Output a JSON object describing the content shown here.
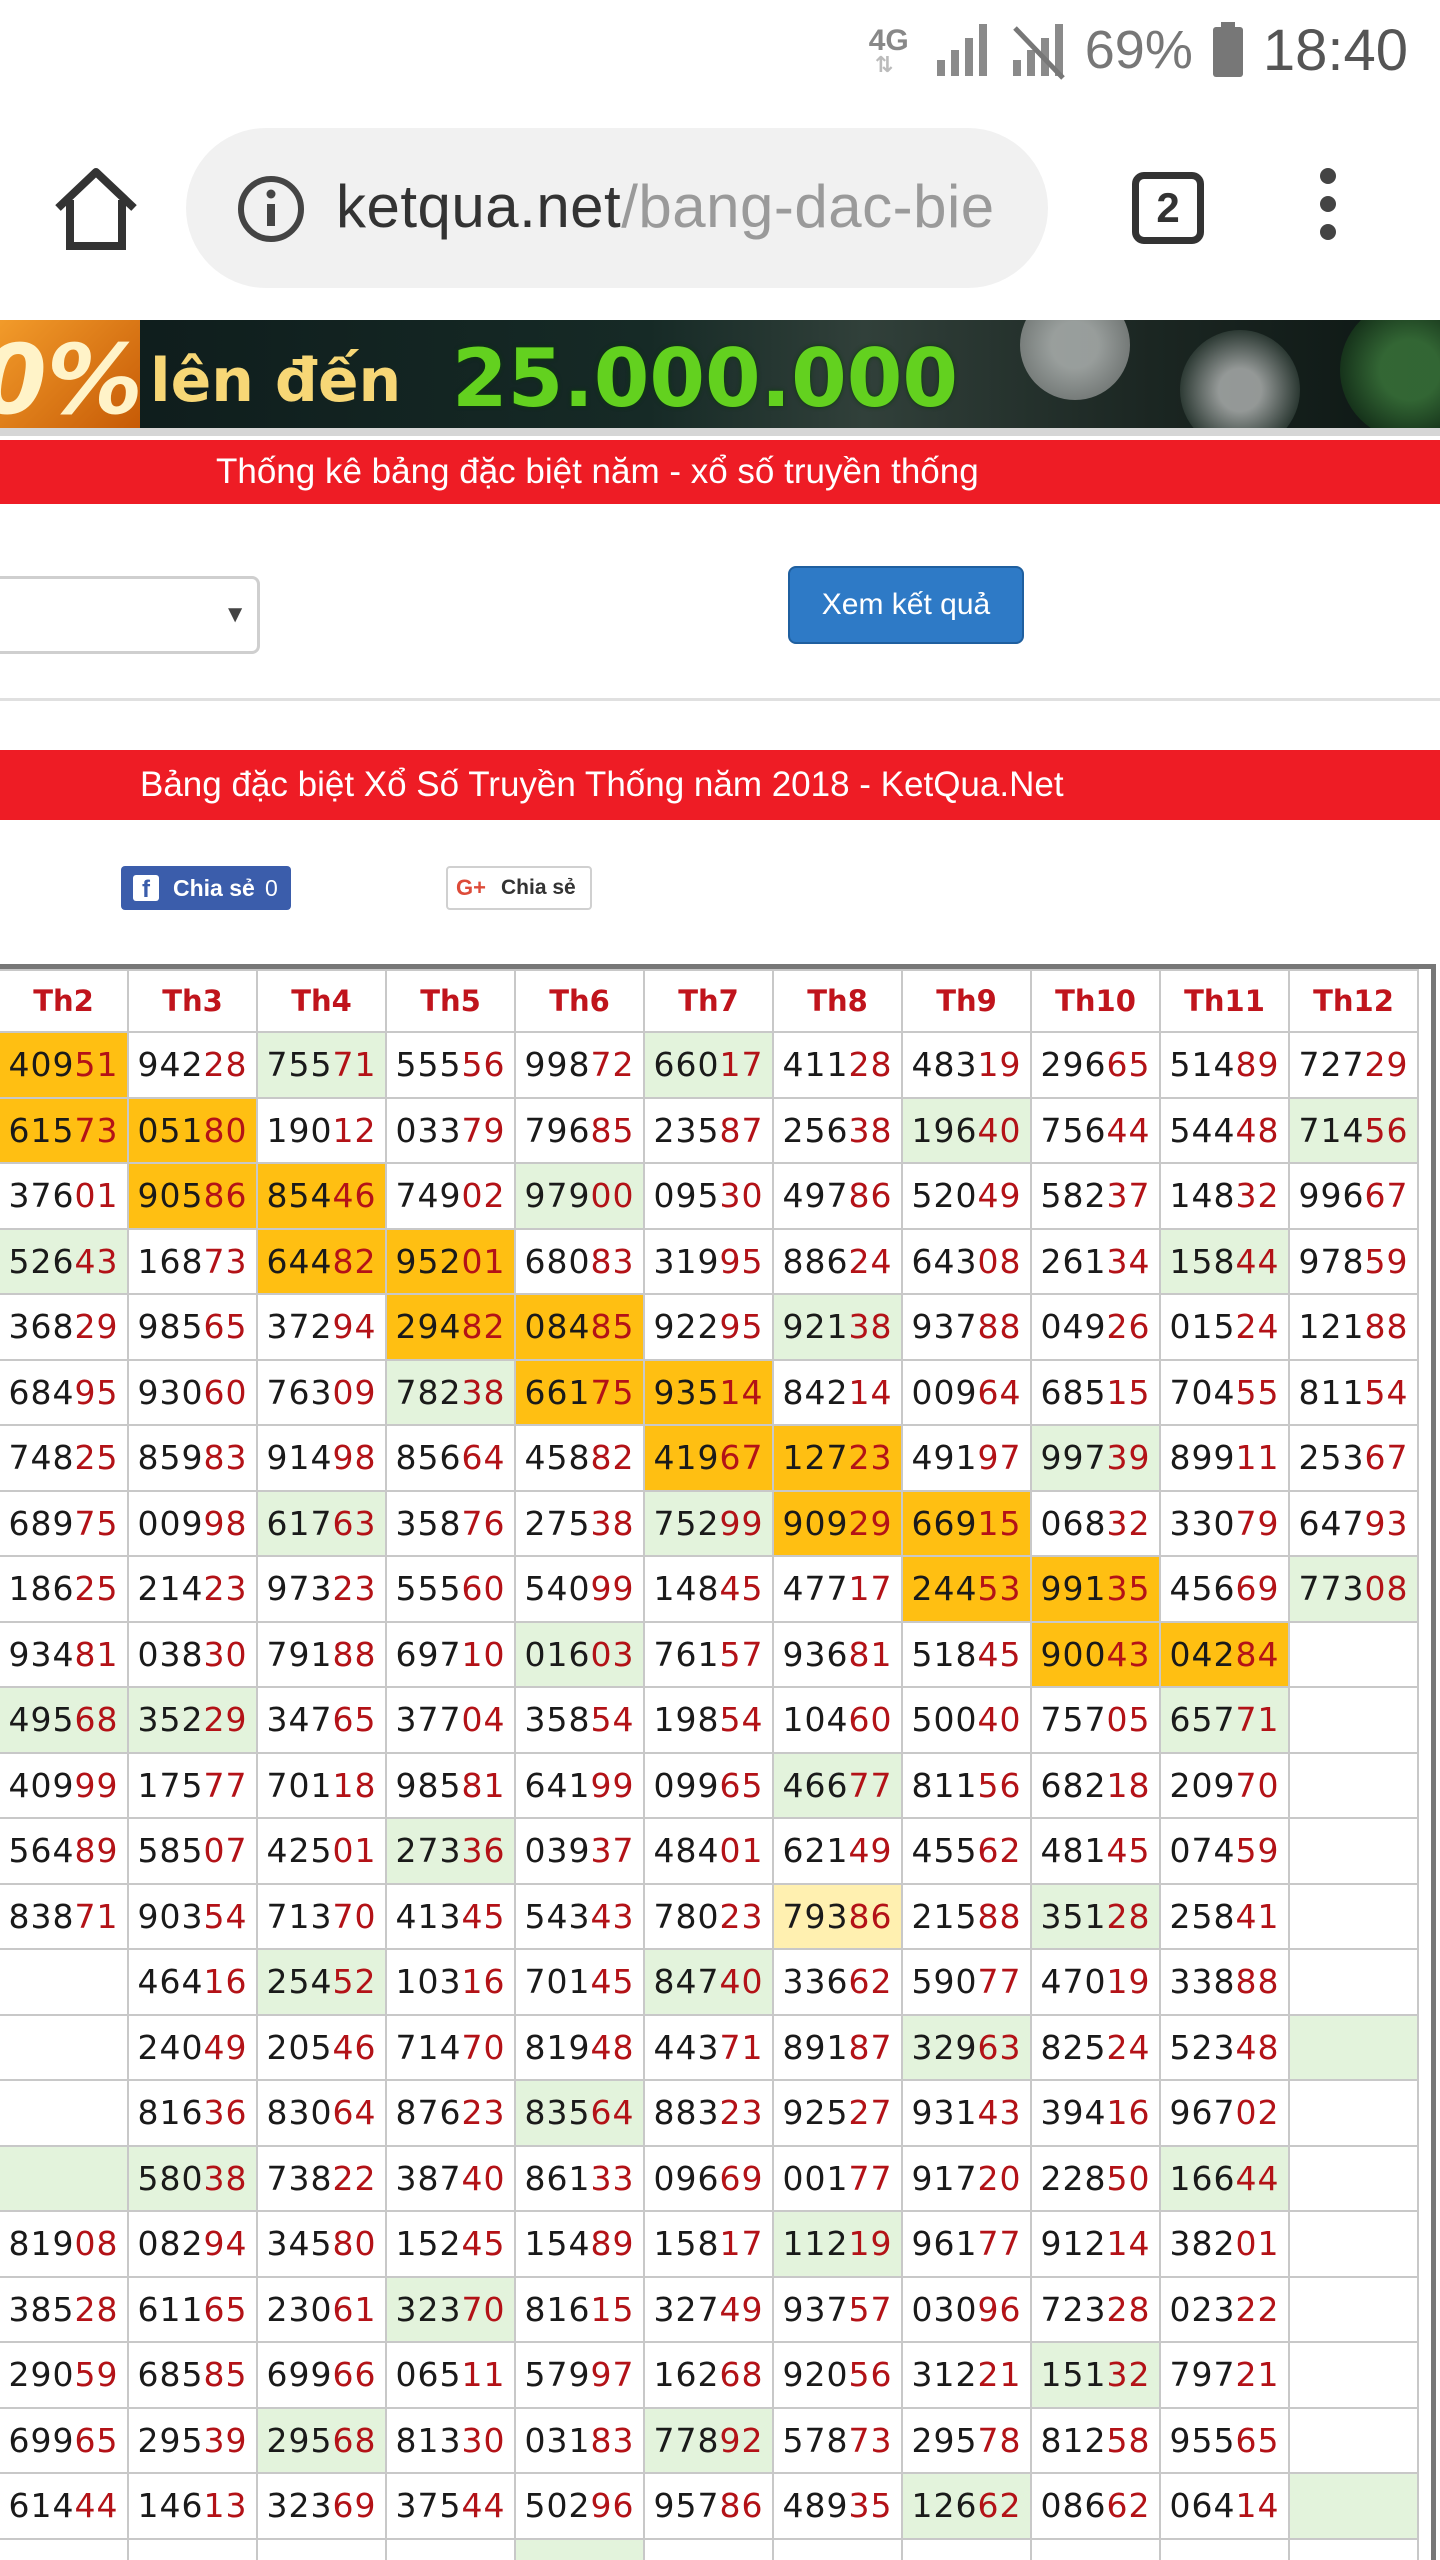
{
  "status_bar": {
    "network": "4G",
    "battery_percent": "69%",
    "time": "18:40",
    "icons": [
      "4g-icon",
      "signal-icon",
      "no-signal-icon",
      "battery-icon"
    ]
  },
  "browser": {
    "url_domain": "ketqua.net",
    "url_path": "/bang-dac-bie",
    "tab_count": "2",
    "icons": [
      "home-icon",
      "info-icon",
      "tabs-icon",
      "menu-icon"
    ]
  },
  "banner": {
    "percent": "0%",
    "text": "lên đến",
    "amount": "25.000.000"
  },
  "stats_header": "Thống kê bảng đặc biệt năm - xổ số truyền thống",
  "form": {
    "select_value": "",
    "submit_label": "Xem kết quả"
  },
  "table_title": "Bảng đặc biệt Xổ Số Truyền Thống năm 2018 - KetQua.Net",
  "share": {
    "facebook_label": "Chia sẻ",
    "facebook_count": "0",
    "google_label": "Chia sẻ"
  },
  "colors": {
    "header_red": "#ee1c25",
    "button_blue": "#2e7ac6",
    "highlight_orange": "#ffbf12",
    "highlight_green": "#e3f3dc",
    "highlight_yellow": "#fff0b0",
    "number_tail_red": "#b31217"
  },
  "table": {
    "columns": [
      "Th2",
      "Th3",
      "Th4",
      "Th5",
      "Th6",
      "Th7",
      "Th8",
      "Th9",
      "Th10",
      "Th11",
      "Th12"
    ],
    "rows": [
      [
        {
          "v": "40951",
          "h": "o"
        },
        {
          "v": "94228"
        },
        {
          "v": "75571",
          "h": "g"
        },
        {
          "v": "55556"
        },
        {
          "v": "99872"
        },
        {
          "v": "66017",
          "h": "g"
        },
        {
          "v": "41128"
        },
        {
          "v": "48319"
        },
        {
          "v": "29665"
        },
        {
          "v": "51489"
        },
        {
          "v": "72729"
        }
      ],
      [
        {
          "v": "61573",
          "h": "o"
        },
        {
          "v": "05180",
          "h": "o"
        },
        {
          "v": "19012"
        },
        {
          "v": "03379"
        },
        {
          "v": "79685"
        },
        {
          "v": "23587"
        },
        {
          "v": "25638"
        },
        {
          "v": "19640",
          "h": "g"
        },
        {
          "v": "75644"
        },
        {
          "v": "54448"
        },
        {
          "v": "71456",
          "h": "g"
        }
      ],
      [
        {
          "v": "37601"
        },
        {
          "v": "90586",
          "h": "o"
        },
        {
          "v": "85446",
          "h": "o"
        },
        {
          "v": "74902"
        },
        {
          "v": "97900",
          "h": "g"
        },
        {
          "v": "09530"
        },
        {
          "v": "49786"
        },
        {
          "v": "52049"
        },
        {
          "v": "58237"
        },
        {
          "v": "14832"
        },
        {
          "v": "99667"
        }
      ],
      [
        {
          "v": "52643",
          "h": "g"
        },
        {
          "v": "16873"
        },
        {
          "v": "64482",
          "h": "o"
        },
        {
          "v": "95201",
          "h": "o"
        },
        {
          "v": "68083"
        },
        {
          "v": "31995"
        },
        {
          "v": "88624"
        },
        {
          "v": "64308"
        },
        {
          "v": "26134"
        },
        {
          "v": "15844",
          "h": "g"
        },
        {
          "v": "97859"
        }
      ],
      [
        {
          "v": "36829"
        },
        {
          "v": "98565"
        },
        {
          "v": "37294"
        },
        {
          "v": "29482",
          "h": "o"
        },
        {
          "v": "08485",
          "h": "o"
        },
        {
          "v": "92295"
        },
        {
          "v": "92138",
          "h": "g"
        },
        {
          "v": "93788"
        },
        {
          "v": "04926"
        },
        {
          "v": "01524"
        },
        {
          "v": "12188"
        }
      ],
      [
        {
          "v": "68495"
        },
        {
          "v": "93060"
        },
        {
          "v": "76309"
        },
        {
          "v": "78238",
          "h": "g"
        },
        {
          "v": "66175",
          "h": "o"
        },
        {
          "v": "93514",
          "h": "o"
        },
        {
          "v": "84214"
        },
        {
          "v": "00964"
        },
        {
          "v": "68515"
        },
        {
          "v": "70455"
        },
        {
          "v": "81154"
        }
      ],
      [
        {
          "v": "74825"
        },
        {
          "v": "85983"
        },
        {
          "v": "91498"
        },
        {
          "v": "85664"
        },
        {
          "v": "45882"
        },
        {
          "v": "41967",
          "h": "o"
        },
        {
          "v": "12723",
          "h": "o"
        },
        {
          "v": "49197"
        },
        {
          "v": "99739",
          "h": "g"
        },
        {
          "v": "89911"
        },
        {
          "v": "25367"
        }
      ],
      [
        {
          "v": "68975"
        },
        {
          "v": "00998"
        },
        {
          "v": "61763",
          "h": "g"
        },
        {
          "v": "35876"
        },
        {
          "v": "27538"
        },
        {
          "v": "75299",
          "h": "g"
        },
        {
          "v": "90929",
          "h": "o"
        },
        {
          "v": "66915",
          "h": "o"
        },
        {
          "v": "06832"
        },
        {
          "v": "33079"
        },
        {
          "v": "64793"
        }
      ],
      [
        {
          "v": "18625"
        },
        {
          "v": "21423"
        },
        {
          "v": "97323"
        },
        {
          "v": "55560"
        },
        {
          "v": "54099"
        },
        {
          "v": "14845"
        },
        {
          "v": "47717"
        },
        {
          "v": "24453",
          "h": "o"
        },
        {
          "v": "99135",
          "h": "o"
        },
        {
          "v": "45669"
        },
        {
          "v": "77308",
          "h": "g"
        }
      ],
      [
        {
          "v": "93481"
        },
        {
          "v": "03830"
        },
        {
          "v": "79188"
        },
        {
          "v": "69710"
        },
        {
          "v": "01603",
          "h": "g"
        },
        {
          "v": "76157"
        },
        {
          "v": "93681"
        },
        {
          "v": "51845"
        },
        {
          "v": "90043",
          "h": "o"
        },
        {
          "v": "04284",
          "h": "o"
        },
        {
          "v": ""
        }
      ],
      [
        {
          "v": "49568",
          "h": "g"
        },
        {
          "v": "35229",
          "h": "g"
        },
        {
          "v": "34765"
        },
        {
          "v": "37704"
        },
        {
          "v": "35854"
        },
        {
          "v": "19854"
        },
        {
          "v": "10460"
        },
        {
          "v": "50040"
        },
        {
          "v": "75705"
        },
        {
          "v": "65771",
          "h": "g"
        },
        {
          "v": ""
        }
      ],
      [
        {
          "v": "40999"
        },
        {
          "v": "17577"
        },
        {
          "v": "70118"
        },
        {
          "v": "98581"
        },
        {
          "v": "64199"
        },
        {
          "v": "09965"
        },
        {
          "v": "46677",
          "h": "g"
        },
        {
          "v": "81156"
        },
        {
          "v": "68218"
        },
        {
          "v": "20970"
        },
        {
          "v": ""
        }
      ],
      [
        {
          "v": "56489"
        },
        {
          "v": "58507"
        },
        {
          "v": "42501"
        },
        {
          "v": "27336",
          "h": "g"
        },
        {
          "v": "03937"
        },
        {
          "v": "48401"
        },
        {
          "v": "62149"
        },
        {
          "v": "45562"
        },
        {
          "v": "48145"
        },
        {
          "v": "07459"
        },
        {
          "v": ""
        }
      ],
      [
        {
          "v": "83871"
        },
        {
          "v": "90354"
        },
        {
          "v": "71370"
        },
        {
          "v": "41345"
        },
        {
          "v": "54343"
        },
        {
          "v": "78023"
        },
        {
          "v": "79386",
          "h": "y"
        },
        {
          "v": "21588"
        },
        {
          "v": "35128",
          "h": "g"
        },
        {
          "v": "25841"
        },
        {
          "v": ""
        }
      ],
      [
        {
          "v": ""
        },
        {
          "v": "46416"
        },
        {
          "v": "25452",
          "h": "g"
        },
        {
          "v": "10316"
        },
        {
          "v": "70145"
        },
        {
          "v": "84740",
          "h": "g"
        },
        {
          "v": "33662"
        },
        {
          "v": "59077"
        },
        {
          "v": "47019"
        },
        {
          "v": "33888"
        },
        {
          "v": ""
        }
      ],
      [
        {
          "v": ""
        },
        {
          "v": "24049"
        },
        {
          "v": "20546"
        },
        {
          "v": "71470"
        },
        {
          "v": "81948"
        },
        {
          "v": "44371"
        },
        {
          "v": "89187"
        },
        {
          "v": "32963",
          "h": "g"
        },
        {
          "v": "82524"
        },
        {
          "v": "52348"
        },
        {
          "v": "",
          "h": "g"
        }
      ],
      [
        {
          "v": ""
        },
        {
          "v": "81636"
        },
        {
          "v": "83064"
        },
        {
          "v": "87623"
        },
        {
          "v": "83564",
          "h": "g"
        },
        {
          "v": "88323"
        },
        {
          "v": "92527"
        },
        {
          "v": "93143"
        },
        {
          "v": "39416"
        },
        {
          "v": "96702"
        },
        {
          "v": ""
        }
      ],
      [
        {
          "v": "",
          "h": "g"
        },
        {
          "v": "58038",
          "h": "g"
        },
        {
          "v": "73822"
        },
        {
          "v": "38740"
        },
        {
          "v": "86133"
        },
        {
          "v": "09669"
        },
        {
          "v": "00177"
        },
        {
          "v": "91720"
        },
        {
          "v": "22850"
        },
        {
          "v": "16644",
          "h": "g"
        },
        {
          "v": ""
        }
      ],
      [
        {
          "v": "81908"
        },
        {
          "v": "08294"
        },
        {
          "v": "34580"
        },
        {
          "v": "15245"
        },
        {
          "v": "15489"
        },
        {
          "v": "15817"
        },
        {
          "v": "11219",
          "h": "g"
        },
        {
          "v": "96177"
        },
        {
          "v": "91214"
        },
        {
          "v": "38201"
        },
        {
          "v": ""
        }
      ],
      [
        {
          "v": "38528"
        },
        {
          "v": "61165"
        },
        {
          "v": "23061"
        },
        {
          "v": "32370",
          "h": "g"
        },
        {
          "v": "81615"
        },
        {
          "v": "32749"
        },
        {
          "v": "93757"
        },
        {
          "v": "03096"
        },
        {
          "v": "72328"
        },
        {
          "v": "02322"
        },
        {
          "v": ""
        }
      ],
      [
        {
          "v": "29059"
        },
        {
          "v": "68585"
        },
        {
          "v": "69966"
        },
        {
          "v": "06511"
        },
        {
          "v": "57997"
        },
        {
          "v": "16268"
        },
        {
          "v": "92056"
        },
        {
          "v": "31221"
        },
        {
          "v": "15132",
          "h": "g"
        },
        {
          "v": "79721"
        },
        {
          "v": ""
        }
      ],
      [
        {
          "v": "69965"
        },
        {
          "v": "29539"
        },
        {
          "v": "29568",
          "h": "g"
        },
        {
          "v": "81330"
        },
        {
          "v": "03183"
        },
        {
          "v": "77892",
          "h": "g"
        },
        {
          "v": "57873"
        },
        {
          "v": "29578"
        },
        {
          "v": "81258"
        },
        {
          "v": "95565"
        },
        {
          "v": ""
        }
      ],
      [
        {
          "v": "61444"
        },
        {
          "v": "14613"
        },
        {
          "v": "32369"
        },
        {
          "v": "37544"
        },
        {
          "v": "50296"
        },
        {
          "v": "95786"
        },
        {
          "v": "48935"
        },
        {
          "v": "12662",
          "h": "g"
        },
        {
          "v": "08662"
        },
        {
          "v": "06414"
        },
        {
          "v": "",
          "h": "g"
        }
      ],
      [
        {
          "v": ""
        },
        {
          "v": ""
        },
        {
          "v": ""
        },
        {
          "v": ""
        },
        {
          "v": "",
          "h": "g"
        },
        {
          "v": ""
        },
        {
          "v": ""
        },
        {
          "v": ""
        },
        {
          "v": ""
        },
        {
          "v": ""
        },
        {
          "v": ""
        }
      ]
    ]
  }
}
